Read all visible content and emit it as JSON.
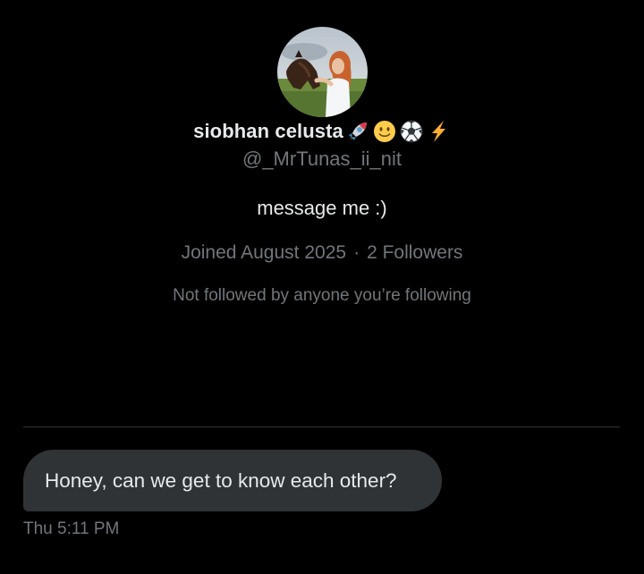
{
  "profile": {
    "display_name": "siobhan celusta",
    "name_emojis": [
      "rocket-icon",
      "slightly-smiling-face-icon",
      "soccer-ball-icon",
      "high-voltage-icon"
    ],
    "handle": "@_MrTunas_ii_nit",
    "bio": "message me :)",
    "joined": "Joined August 2025",
    "separator": "·",
    "followers": "2 Followers",
    "not_followed": "Not followed by anyone you’re following"
  },
  "conversation": {
    "messages": [
      {
        "text": "Honey, can we get to know each other?",
        "timestamp": "Thu 5:11 PM"
      }
    ]
  },
  "colors": {
    "background": "#000000",
    "primary_text": "#e7e9ea",
    "secondary_text": "#71767b",
    "bubble": "#2f3336",
    "divider": "#2f3336"
  }
}
